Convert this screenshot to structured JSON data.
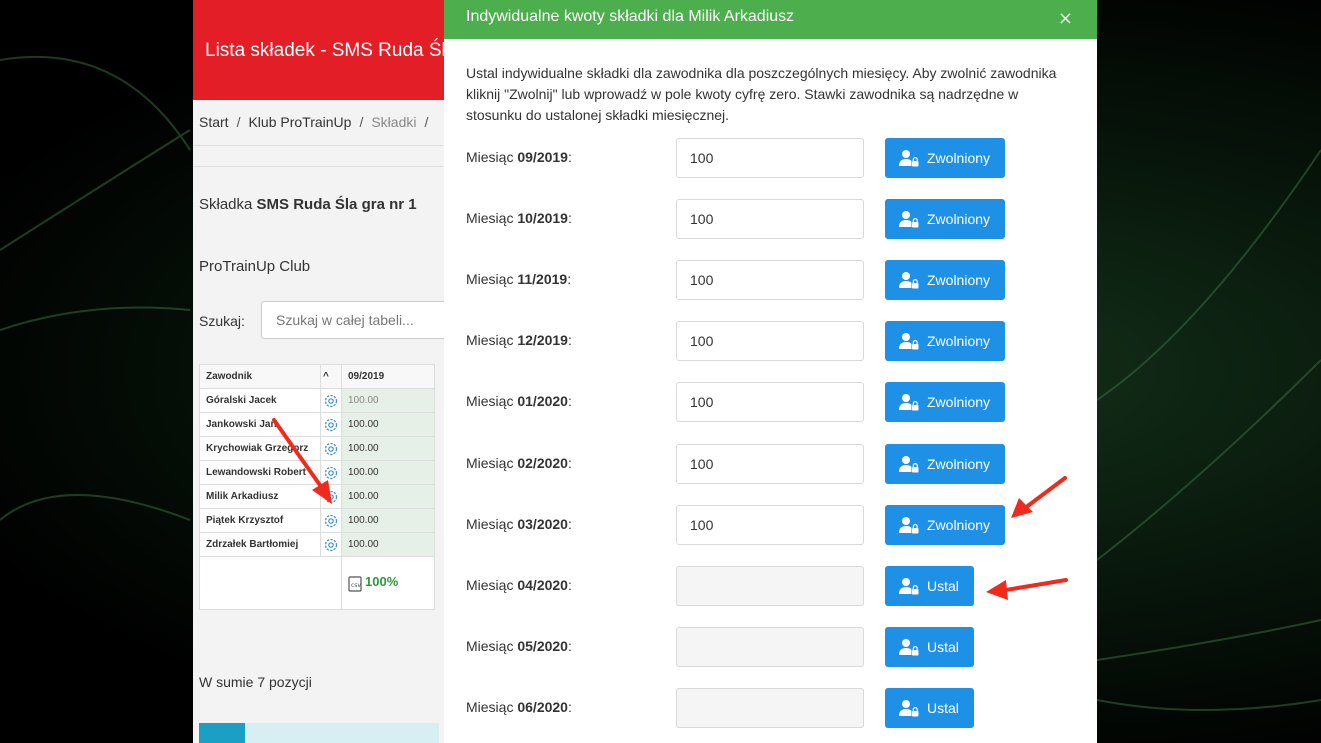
{
  "app": {
    "title": "Lista składek - SMS Ruda Śląska",
    "breadcrumb": [
      "Start",
      "Klub ProTrainUp",
      "Składki"
    ],
    "fee_title_prefix": "Składka",
    "fee_title_bold": "SMS Ruda Śla gra nr 1",
    "club_name": "ProTrainUp Club",
    "search_label": "Szukaj:",
    "search_placeholder": "Szukaj w całej tabeli...",
    "table": {
      "col_player": "Zawodnik",
      "col_month": "09/2019",
      "rows": [
        {
          "name": "Góralski Jacek",
          "value": "100.00"
        },
        {
          "name": "Jankowski Jan",
          "value": "100.00"
        },
        {
          "name": "Krychowiak Grzegorz",
          "value": "100.00"
        },
        {
          "name": "Lewandowski Robert",
          "value": "100.00"
        },
        {
          "name": "Milik Arkadiusz",
          "value": "100.00"
        },
        {
          "name": "Piątek Krzysztof",
          "value": "100.00"
        },
        {
          "name": "Zdrzałek Bartłomiej",
          "value": "100.00"
        }
      ],
      "percent": "100%"
    },
    "footer": "W sumie 7 pozycji"
  },
  "modal": {
    "title": "Indywidualne kwoty składki dla Milik Arkadiusz",
    "close": "×",
    "intro": "Ustal indywidualne składki dla zawodnika dla poszczególnych miesięcy. Aby zwolnić zawodnika kliknij \"Zwolnij\" lub wprowadź w pole kwoty cyfrę zero. Stawki zawodnika są nadrzędne w stosunku do ustalonej składki miesięcznej.",
    "month_prefix": "Miesiąc",
    "rows": [
      {
        "month": "09/2019",
        "value": "100",
        "button": "Zwolniony"
      },
      {
        "month": "10/2019",
        "value": "100",
        "button": "Zwolniony"
      },
      {
        "month": "11/2019",
        "value": "100",
        "button": "Zwolniony"
      },
      {
        "month": "12/2019",
        "value": "100",
        "button": "Zwolniony"
      },
      {
        "month": "01/2020",
        "value": "100",
        "button": "Zwolniony"
      },
      {
        "month": "02/2020",
        "value": "100",
        "button": "Zwolniony"
      },
      {
        "month": "03/2020",
        "value": "100",
        "button": "Zwolniony"
      },
      {
        "month": "04/2020",
        "value": "",
        "button": "Ustal"
      },
      {
        "month": "05/2020",
        "value": "",
        "button": "Ustal"
      },
      {
        "month": "06/2020",
        "value": "",
        "button": "Ustal"
      }
    ]
  },
  "colors": {
    "header_red": "#e41e26",
    "modal_green": "#4cae4c",
    "button_blue": "#1e90e6",
    "arrow_red": "#ee2b1c",
    "percent_green": "#2e9b3a"
  },
  "icons": [
    "gear-icon",
    "user-lock-icon",
    "close-icon",
    "document-icon",
    "sort-icon"
  ]
}
